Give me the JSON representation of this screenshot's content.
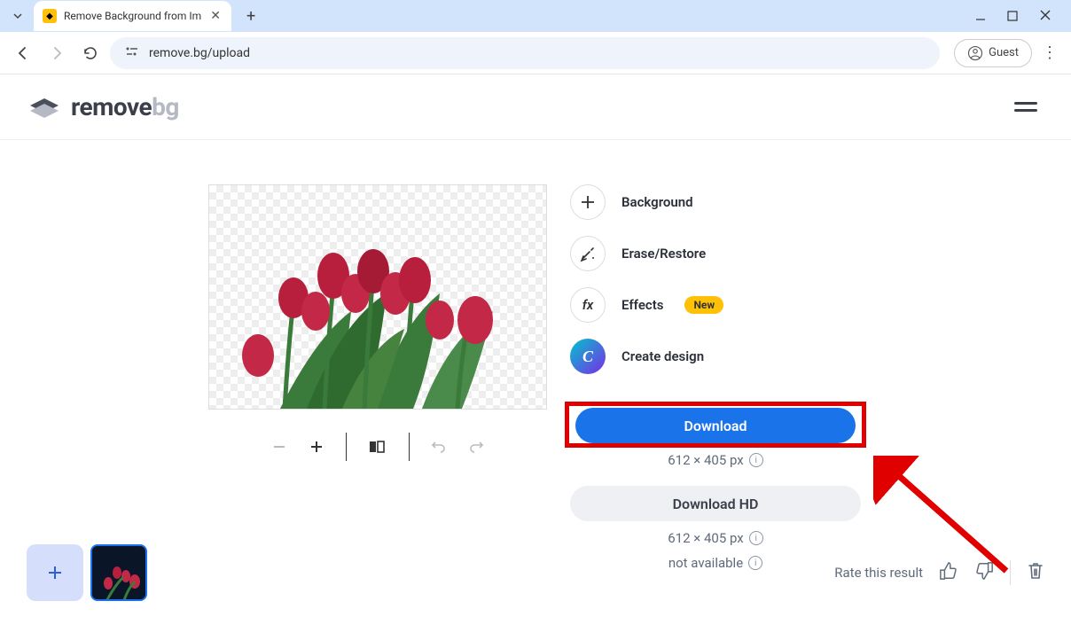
{
  "browser": {
    "tab_title": "Remove Background from Im",
    "url": "remove.bg/upload",
    "guest_label": "Guest"
  },
  "site": {
    "logo_part1": "remove",
    "logo_part2": "bg"
  },
  "actions": {
    "background": "Background",
    "erase_restore": "Erase/Restore",
    "effects": "Effects",
    "effects_badge": "New",
    "create_design": "Create design"
  },
  "downloads": {
    "download_label": "Download",
    "download_size": "612 × 405 px",
    "download_hd_label": "Download HD",
    "download_hd_size": "612 × 405 px",
    "not_available": "not available"
  },
  "footer": {
    "rate_label": "Rate this result"
  }
}
